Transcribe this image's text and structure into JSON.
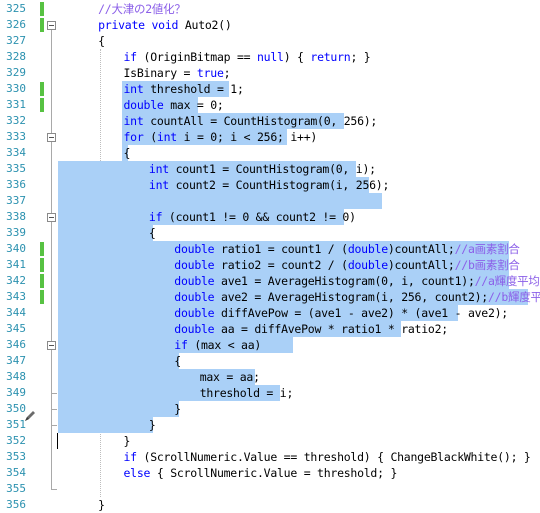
{
  "lines": [
    {
      "num": "325",
      "indent": 6,
      "tokens": [
        {
          "c": "cm",
          "t": "//大津の2値化？"
        }
      ]
    },
    {
      "num": "326",
      "indent": 6,
      "tokens": [
        {
          "c": "kw",
          "t": "private void"
        },
        {
          "c": "",
          "t": " Auto2()"
        }
      ]
    },
    {
      "num": "327",
      "indent": 6,
      "tokens": [
        {
          "c": "",
          "t": "{"
        }
      ]
    },
    {
      "num": "328",
      "indent": 10,
      "tokens": [
        {
          "c": "kw",
          "t": "if"
        },
        {
          "c": "",
          "t": " (OriginBitmap == "
        },
        {
          "c": "kw",
          "t": "null"
        },
        {
          "c": "",
          "t": ") { "
        },
        {
          "c": "kw",
          "t": "return"
        },
        {
          "c": "",
          "t": "; }"
        }
      ]
    },
    {
      "num": "329",
      "indent": 10,
      "tokens": [
        {
          "c": "",
          "t": "IsBinary = "
        },
        {
          "c": "kw",
          "t": "true"
        },
        {
          "c": "",
          "t": ";"
        }
      ]
    },
    {
      "num": "330",
      "indent": 10,
      "tokens": [
        {
          "c": "kw",
          "t": "int"
        },
        {
          "c": "",
          "t": " threshold = 1;"
        }
      ]
    },
    {
      "num": "331",
      "indent": 10,
      "tokens": [
        {
          "c": "kw",
          "t": "double"
        },
        {
          "c": "",
          "t": " max = 0;"
        }
      ]
    },
    {
      "num": "332",
      "indent": 10,
      "tokens": [
        {
          "c": "kw",
          "t": "int"
        },
        {
          "c": "",
          "t": " countAll = CountHistogram(0, 256);"
        }
      ]
    },
    {
      "num": "333",
      "indent": 10,
      "tokens": [
        {
          "c": "kw",
          "t": "for"
        },
        {
          "c": "",
          "t": " ("
        },
        {
          "c": "kw",
          "t": "int"
        },
        {
          "c": "",
          "t": " i = 0; i < 256; i++)"
        }
      ]
    },
    {
      "num": "334",
      "indent": 10,
      "tokens": [
        {
          "c": "",
          "t": "{"
        }
      ]
    },
    {
      "num": "335",
      "indent": 14,
      "tokens": [
        {
          "c": "kw",
          "t": "int"
        },
        {
          "c": "",
          "t": " count1 = CountHistogram(0, i);"
        }
      ]
    },
    {
      "num": "336",
      "indent": 14,
      "tokens": [
        {
          "c": "kw",
          "t": "int"
        },
        {
          "c": "",
          "t": " count2 = CountHistogram(i, 256);"
        }
      ]
    },
    {
      "num": "337",
      "indent": 0,
      "tokens": []
    },
    {
      "num": "338",
      "indent": 14,
      "tokens": [
        {
          "c": "kw",
          "t": "if"
        },
        {
          "c": "",
          "t": " (count1 != 0 && count2 != 0)"
        }
      ]
    },
    {
      "num": "339",
      "indent": 14,
      "tokens": [
        {
          "c": "",
          "t": "{"
        }
      ]
    },
    {
      "num": "340",
      "indent": 18,
      "tokens": [
        {
          "c": "kw",
          "t": "double"
        },
        {
          "c": "",
          "t": " ratio1 = count1 / ("
        },
        {
          "c": "kw",
          "t": "double"
        },
        {
          "c": "",
          "t": ")countAll;"
        },
        {
          "c": "cm",
          "t": "//a画素割合"
        }
      ]
    },
    {
      "num": "341",
      "indent": 18,
      "tokens": [
        {
          "c": "kw",
          "t": "double"
        },
        {
          "c": "",
          "t": " ratio2 = count2 / ("
        },
        {
          "c": "kw",
          "t": "double"
        },
        {
          "c": "",
          "t": ")countAll;"
        },
        {
          "c": "cm",
          "t": "//b画素割合"
        }
      ]
    },
    {
      "num": "342",
      "indent": 18,
      "tokens": [
        {
          "c": "kw",
          "t": "double"
        },
        {
          "c": "",
          "t": " ave1 = AverageHistogram(0, i, count1);"
        },
        {
          "c": "cm",
          "t": "//a輝度平均"
        }
      ]
    },
    {
      "num": "343",
      "indent": 18,
      "tokens": [
        {
          "c": "kw",
          "t": "double"
        },
        {
          "c": "",
          "t": " ave2 = AverageHistogram(i, 256, count2);"
        },
        {
          "c": "cm",
          "t": "//b輝度平均"
        }
      ]
    },
    {
      "num": "344",
      "indent": 18,
      "tokens": [
        {
          "c": "kw",
          "t": "double"
        },
        {
          "c": "",
          "t": " diffAvePow = (ave1 - ave2) * (ave1 - ave2);"
        }
      ]
    },
    {
      "num": "345",
      "indent": 18,
      "tokens": [
        {
          "c": "kw",
          "t": "double"
        },
        {
          "c": "",
          "t": " aa = diffAvePow * ratio1 * ratio2;"
        }
      ]
    },
    {
      "num": "346",
      "indent": 18,
      "tokens": [
        {
          "c": "kw",
          "t": "if"
        },
        {
          "c": "",
          "t": " (max < aa)"
        }
      ]
    },
    {
      "num": "347",
      "indent": 18,
      "tokens": [
        {
          "c": "",
          "t": "{"
        }
      ]
    },
    {
      "num": "348",
      "indent": 22,
      "tokens": [
        {
          "c": "",
          "t": "max = aa;"
        }
      ]
    },
    {
      "num": "349",
      "indent": 22,
      "tokens": [
        {
          "c": "",
          "t": "threshold = i;"
        }
      ]
    },
    {
      "num": "350",
      "indent": 18,
      "tokens": [
        {
          "c": "",
          "t": "}"
        }
      ]
    },
    {
      "num": "351",
      "indent": 14,
      "tokens": [
        {
          "c": "",
          "t": "}"
        }
      ]
    },
    {
      "num": "352",
      "indent": 10,
      "tokens": [
        {
          "c": "",
          "t": "}"
        }
      ]
    },
    {
      "num": "353",
      "indent": 10,
      "tokens": [
        {
          "c": "kw",
          "t": "if"
        },
        {
          "c": "",
          "t": " (ScrollNumeric.Value == threshold) { ChangeBlackWhite(); }"
        }
      ]
    },
    {
      "num": "354",
      "indent": 10,
      "tokens": [
        {
          "c": "kw",
          "t": "else"
        },
        {
          "c": "",
          "t": " { ScrollNumeric.Value = threshold; }"
        }
      ]
    },
    {
      "num": "355",
      "indent": 0,
      "tokens": []
    },
    {
      "num": "356",
      "indent": 6,
      "tokens": [
        {
          "c": "",
          "t": "}"
        }
      ]
    }
  ],
  "colors": {
    "line_number": "#2b91af",
    "keyword": "#0000ff",
    "comment": "#8b5fe8",
    "selection": "#aad0f7",
    "change_marker": "#57c242"
  },
  "icons": {
    "fold_button": "outline-collapse-icon",
    "margin_glyph": "pencil-icon"
  }
}
